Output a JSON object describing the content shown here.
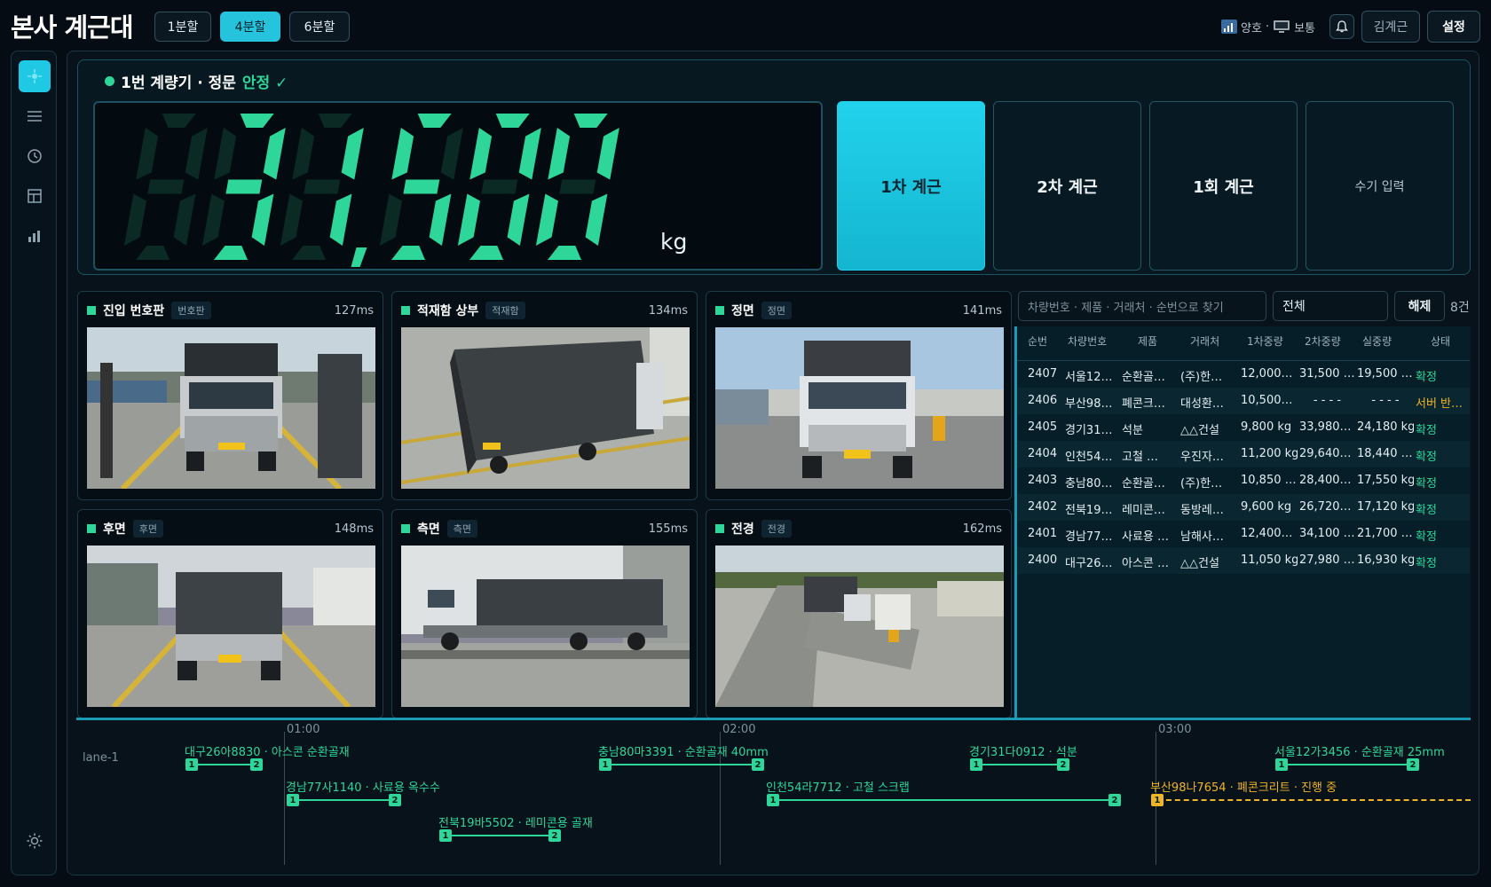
{
  "app_title": "본사 계근대",
  "split_buttons": [
    "1분할",
    "4분할",
    "6분할"
  ],
  "header": {
    "signal_label": "양호",
    "separator": "·",
    "monitor_label": "보통",
    "user": "김계근",
    "settings": "설정"
  },
  "nav_icons": [
    "scale-icon",
    "menu-icon",
    "clock-icon",
    "layout-icon",
    "chart-icon",
    "settings-sun-icon"
  ],
  "scale": {
    "title": "1번 계량기 · 정문",
    "status": "안정",
    "check": "✓",
    "weight": "31,500",
    "unit": "kg"
  },
  "weigh_buttons": [
    "1차 계근",
    "2차 계근",
    "1회 계근",
    "수기 입력"
  ],
  "cameras": [
    {
      "title": "진입 번호판",
      "tag": "번호판",
      "ms": "127ms"
    },
    {
      "title": "적재함 상부",
      "tag": "적재함",
      "ms": "134ms"
    },
    {
      "title": "정면",
      "tag": "정면",
      "ms": "141ms"
    },
    {
      "title": "후면",
      "tag": "후면",
      "ms": "148ms"
    },
    {
      "title": "측면",
      "tag": "측면",
      "ms": "155ms"
    },
    {
      "title": "전경",
      "tag": "전경",
      "ms": "162ms"
    }
  ],
  "table": {
    "search_placeholder": "차량번호 · 제품 · 거래처 · 순번으로 찾기",
    "filter": "전체",
    "clear": "해제",
    "count": "8건",
    "headers": [
      "순번",
      "차량번호",
      "제품",
      "거래처",
      "1차중량",
      "2차중량",
      "실중량",
      "상태"
    ],
    "rows": [
      [
        "2407",
        "서울12…",
        "순환골…",
        "(주)한…",
        "12,000…",
        "31,500 …",
        "19,500 …",
        "확정"
      ],
      [
        "2406",
        "부산98…",
        "폐콘크…",
        "대성환…",
        "10,500…",
        "- - - -",
        "- - - -",
        "서버 반…"
      ],
      [
        "2405",
        "경기31…",
        "석분",
        "△△건설",
        "9,800 kg",
        "33,980…",
        "24,180 kg",
        "확정"
      ],
      [
        "2404",
        "인천54…",
        "고철 …",
        "우진자…",
        "11,200 kg",
        "29,640…",
        "18,440 …",
        "확정"
      ],
      [
        "2403",
        "충남80…",
        "순환골…",
        "(주)한…",
        "10,850 …",
        "28,400…",
        "17,550 kg",
        "확정"
      ],
      [
        "2402",
        "전북19…",
        "레미콘…",
        "동방레…",
        "9,600 kg",
        "26,720…",
        "17,120 kg",
        "확정"
      ],
      [
        "2401",
        "경남77…",
        "사료용 …",
        "남해사…",
        "12,400…",
        "34,100 …",
        "21,700 …",
        "확정"
      ],
      [
        "2400",
        "대구26…",
        "아스콘 …",
        "△△건설",
        "11,050 kg",
        "27,980 …",
        "16,930 kg",
        "확정"
      ]
    ]
  },
  "timeline": {
    "lane": "lane-1",
    "ticks": [
      "01:00",
      "02:00",
      "03:00"
    ],
    "entries": [
      {
        "label": "대구26아8830 · 아스콘 순환골재",
        "m1": "1",
        "m2": "2"
      },
      {
        "label": "경남77사1140 · 사료용 옥수수",
        "m1": "1",
        "m2": "2"
      },
      {
        "label": "전북19바5502 · 레미콘용 골재",
        "m1": "1",
        "m2": "2"
      },
      {
        "label": "충남80마3391 · 순환골재 40mm",
        "m1": "1",
        "m2": "2"
      },
      {
        "label": "인천54라7712 · 고철 스크랩",
        "m1": "1",
        "m2": "2"
      },
      {
        "label": "경기31다0912 · 석분",
        "m1": "1",
        "m2": "2"
      },
      {
        "label": "서울12가3456 · 순환골재 25mm",
        "m1": "1",
        "m2": "2"
      },
      {
        "label": "부산98나7654 · 폐콘크리트 · 진행 중",
        "m1": "1"
      }
    ]
  },
  "colors": {
    "accent": "#25c3dc",
    "ok": "#2fd69a",
    "warn": "#f0b429",
    "bg": "#050c13"
  }
}
